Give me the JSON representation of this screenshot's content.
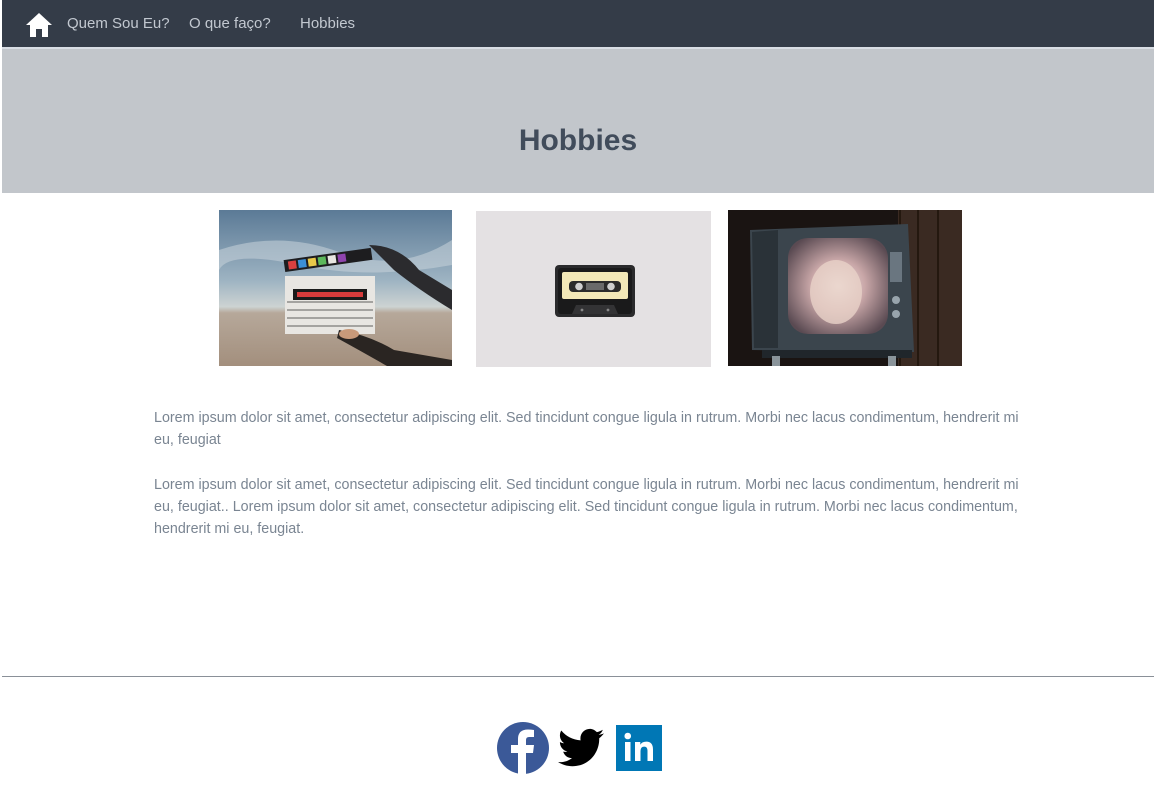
{
  "nav": {
    "home_icon": "home-icon",
    "links": [
      {
        "label": "Quem Sou Eu?"
      },
      {
        "label": "O que faço?"
      },
      {
        "label": "Hobbies"
      }
    ],
    "background": "#343c48",
    "link_color": "#c2c8d0"
  },
  "banner": {
    "title": "Hobbies",
    "background": "#c2c6cb",
    "title_color": "#414c5b"
  },
  "photos": [
    {
      "subject": "clapperboard-photo"
    },
    {
      "subject": "cassette-tape-photo"
    },
    {
      "subject": "retro-tv-photo"
    }
  ],
  "content": {
    "paragraphs": [
      "Lorem ipsum dolor sit amet, consectetur adipiscing elit. Sed tincidunt congue ligula in rutrum. Morbi nec lacus condimentum, hendrerit mi eu, feugiat",
      "Lorem ipsum dolor sit amet, consectetur adipiscing elit. Sed tincidunt congue ligula in rutrum. Morbi nec lacus condimentum, hendrerit mi eu, feugiat.. Lorem ipsum dolor sit amet, consectetur adipiscing elit. Sed tincidunt congue ligula in rutrum. Morbi nec lacus condimentum, hendrerit mi eu, feugiat."
    ],
    "text_color": "#7a8592"
  },
  "footer": {
    "social": [
      {
        "icon": "facebook-icon",
        "color": "#3b5998"
      },
      {
        "icon": "twitter-icon",
        "color": "#000000"
      },
      {
        "icon": "linkedin-icon",
        "color": "#0077b5"
      }
    ]
  }
}
